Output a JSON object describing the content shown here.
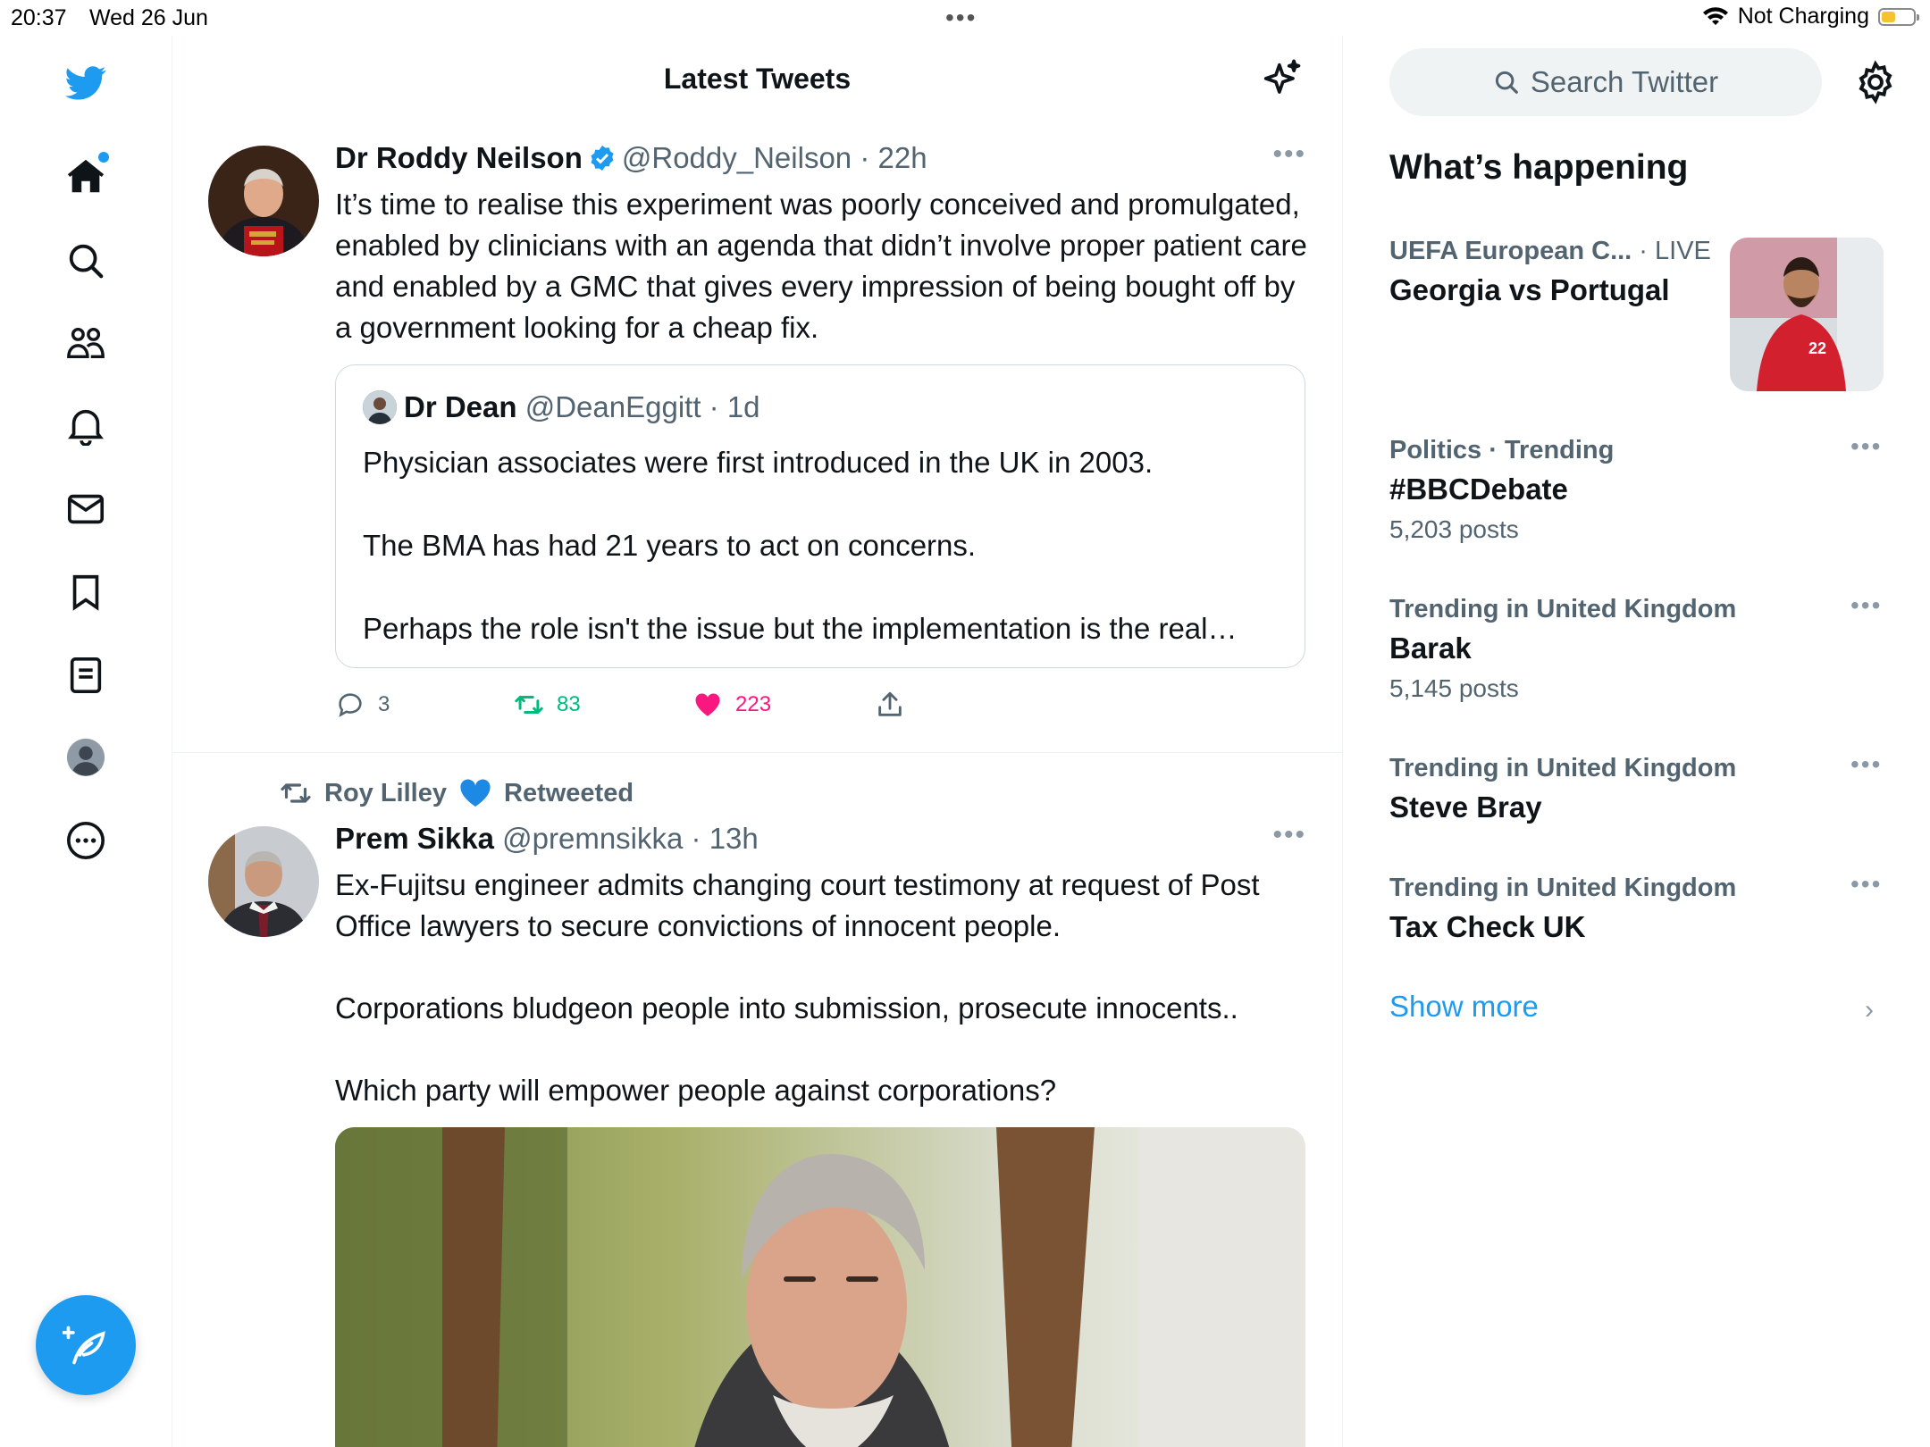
{
  "status_bar": {
    "time": "20:37",
    "date": "Wed 26 Jun",
    "battery_text": "Not Charging",
    "battery_level": 0.45
  },
  "nav": {
    "items": [
      "twitter-logo",
      "home",
      "explore",
      "communities",
      "notifications",
      "messages",
      "bookmarks",
      "lists",
      "profile",
      "more"
    ],
    "accent": "#1d9bf0"
  },
  "main": {
    "title": "Latest Tweets"
  },
  "tweets": [
    {
      "name": "Dr Roddy Neilson",
      "handle": "@Roddy_Neilson",
      "time": "22h",
      "text": "It’s time to realise this experiment was poorly conceived and promulgated, enabled by clinicians with an agenda that didn’t involve proper patient care and enabled by a GMC that gives every impression of being bought off by a government looking for a cheap fix.",
      "quote": {
        "name": "Dr Dean",
        "handle": "@DeanEggitt",
        "time": "1d",
        "lines": [
          "Physician associates were first introduced in the UK in 2003.",
          "The BMA has had 21 years to act on concerns.",
          "Perhaps the role isn't the issue but the  implementation is the real…"
        ]
      },
      "replies": "3",
      "retweets": "83",
      "likes": "223"
    },
    {
      "retweeted_by": "Roy Lilley",
      "retweeted_label": "Retweeted",
      "name": "Prem Sikka",
      "handle": "@premnsikka",
      "time": "13h",
      "paragraphs": [
        "Ex-Fujitsu engineer admits changing court testimony at request of Post Office lawyers to secure convictions of innocent people.",
        "Corporations bludgeon people into submission, prosecute innocents..",
        "Which party will empower people against corporations?"
      ]
    }
  ],
  "sidebar": {
    "search_placeholder": "Search Twitter",
    "heading": "What’s happening",
    "trends": [
      {
        "category": "UEFA European C...",
        "live": "LIVE",
        "title": "Georgia vs Portugal"
      },
      {
        "category": "Politics · Trending",
        "title": "#BBCDebate",
        "count": "5,203 posts"
      },
      {
        "category": "Trending in United Kingdom",
        "title": "Barak",
        "count": "5,145 posts"
      },
      {
        "category": "Trending in United Kingdom",
        "title": "Steve Bray"
      },
      {
        "category": "Trending in United Kingdom",
        "title": "Tax Check UK"
      }
    ],
    "show_more": "Show more"
  }
}
